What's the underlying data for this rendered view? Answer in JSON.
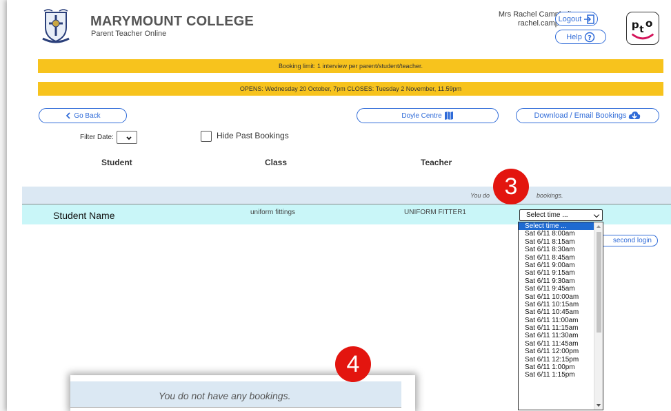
{
  "header": {
    "title": "MARYMOUNT COLLEGE",
    "subtitle": "Parent Teacher Online",
    "user_name": "Mrs Rachel Campbell",
    "user_login": "rachel.campbell",
    "logout_label": "Logout",
    "help_label": "Help",
    "logo_text": "pto"
  },
  "banners": {
    "limit": "Booking limit: 1 interview per parent/student/teacher.",
    "dates": "OPENS: Wednesday 20 October, 7pm CLOSES: Tuesday 2 November, 11.59pm"
  },
  "actions": {
    "go_back": "Go Back",
    "venue": "Doyle Centre",
    "download": "Download / Email Bookings",
    "second_login": "second login"
  },
  "filters": {
    "filter_date_label": "Filter Date:",
    "hide_past_label": "Hide Past Bookings"
  },
  "table": {
    "headers": [
      "Student",
      "Class",
      "Teacher"
    ],
    "no_bookings_left": "You do",
    "no_bookings_right": "bookings.",
    "row": {
      "student": "Student Name",
      "class": "uniform fittings",
      "teacher": "UNIFORM FITTER1",
      "time_selected": "Select time ..."
    }
  },
  "time_options": [
    "Select time ...",
    "Sat 6/11 8:00am",
    "Sat 6/11 8:15am",
    "Sat 6/11 8:30am",
    "Sat 6/11 8:45am",
    "Sat 6/11 9:00am",
    "Sat 6/11 9:15am",
    "Sat 6/11 9:30am",
    "Sat 6/11 9:45am",
    "Sat 6/11 10:00am",
    "Sat 6/11 10:15am",
    "Sat 6/11 10:45am",
    "Sat 6/11 11:00am",
    "Sat 6/11 11:15am",
    "Sat 6/11 11:30am",
    "Sat 6/11 11:45am",
    "Sat 6/11 12:00pm",
    "Sat 6/11 12:15pm",
    "Sat 6/11 1:00pm",
    "Sat 6/11 1:15pm"
  ],
  "callouts": {
    "step3": "3",
    "step4": "4"
  },
  "inset": {
    "message": "You do not have any bookings."
  },
  "colors": {
    "accent": "#2f6bd8",
    "banner": "#f7c31d",
    "row_highlight": "#c9f6f8",
    "callout": "#e3150f"
  }
}
